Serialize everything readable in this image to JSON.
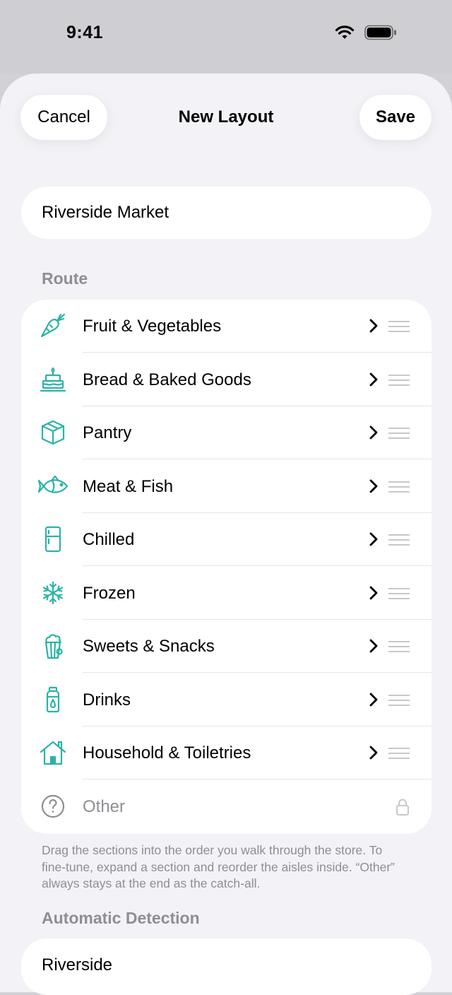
{
  "status": {
    "time": "9:41"
  },
  "nav": {
    "cancel_label": "Cancel",
    "title": "New Layout",
    "save_label": "Save"
  },
  "layout_name": {
    "value": "Riverside Market"
  },
  "route": {
    "header": "Route",
    "items": [
      {
        "label": "Fruit & Vegetables",
        "icon": "carrot-icon"
      },
      {
        "label": "Bread & Baked Goods",
        "icon": "cake-icon"
      },
      {
        "label": "Pantry",
        "icon": "box-icon"
      },
      {
        "label": "Meat & Fish",
        "icon": "fish-icon"
      },
      {
        "label": "Chilled",
        "icon": "fridge-icon"
      },
      {
        "label": "Frozen",
        "icon": "snowflake-icon"
      },
      {
        "label": "Sweets & Snacks",
        "icon": "popcorn-icon"
      },
      {
        "label": "Drinks",
        "icon": "bottle-icon"
      },
      {
        "label": "Household & Toiletries",
        "icon": "house-icon"
      }
    ],
    "other": {
      "label": "Other",
      "icon": "question-circle-icon"
    },
    "footnote": "Drag the sections into the order you walk through the store. To fine-tune, expand a section and reorder the aisles inside. “Other” always stays at the end as the catch-all."
  },
  "automatic_detection": {
    "header": "Automatic Detection",
    "value": "Riverside"
  },
  "colors": {
    "accent": "#2bb3a7",
    "secondary_text": "#8e8e93",
    "background": "#f2f2f7"
  }
}
